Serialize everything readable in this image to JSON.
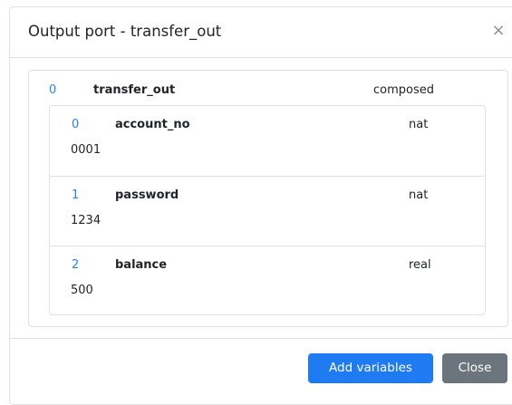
{
  "modal": {
    "title": "Output port - transfer_out",
    "close_glyph": "×"
  },
  "port": {
    "index": "0",
    "name": "transfer_out",
    "type": "composed",
    "variables": [
      {
        "index": "0",
        "name": "account_no",
        "type": "nat",
        "value": "0001"
      },
      {
        "index": "1",
        "name": "password",
        "type": "nat",
        "value": "1234"
      },
      {
        "index": "2",
        "name": "balance",
        "type": "real",
        "value": "500"
      }
    ]
  },
  "footer": {
    "add_label": "Add variables",
    "close_label": "Close"
  },
  "colors": {
    "primary": "#1e7bf2",
    "secondary": "#6c757d",
    "index_blue": "#2f80ed",
    "border": "#dee2e6"
  },
  "icons": {
    "close": "close-icon"
  }
}
